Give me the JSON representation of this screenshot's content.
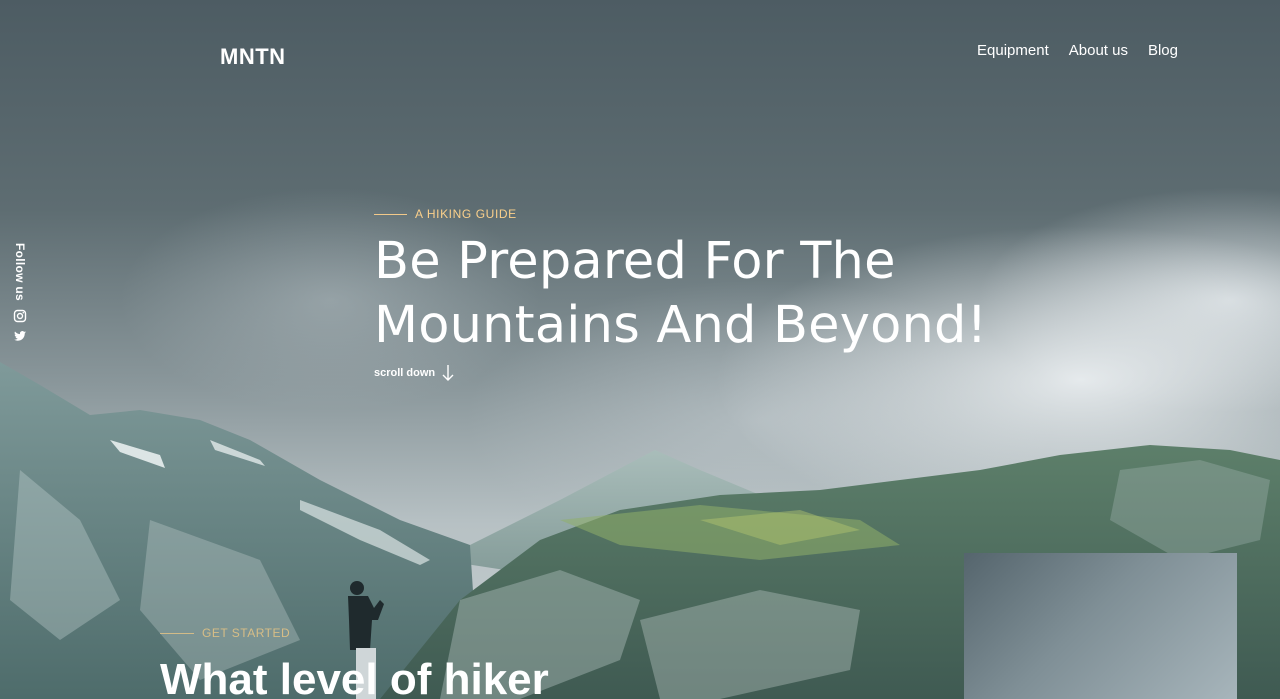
{
  "header": {
    "logo": "MNTN",
    "nav": [
      {
        "label": "Equipment"
      },
      {
        "label": "About us"
      },
      {
        "label": "Blog"
      }
    ]
  },
  "sidebar": {
    "follow_label": "Follow us",
    "social": [
      {
        "icon": "instagram-icon"
      },
      {
        "icon": "twitter-icon"
      }
    ]
  },
  "hero": {
    "eyebrow": "A HIKING GUIDE",
    "title_line1": "Be Prepared For The",
    "title_line2": "Mountains And Beyond!",
    "scroll_label": "scroll down"
  },
  "section": {
    "eyebrow": "GET STARTED",
    "title": "What level of hiker"
  },
  "colors": {
    "accent": "#FBD08B",
    "text": "#FFFFFF"
  }
}
